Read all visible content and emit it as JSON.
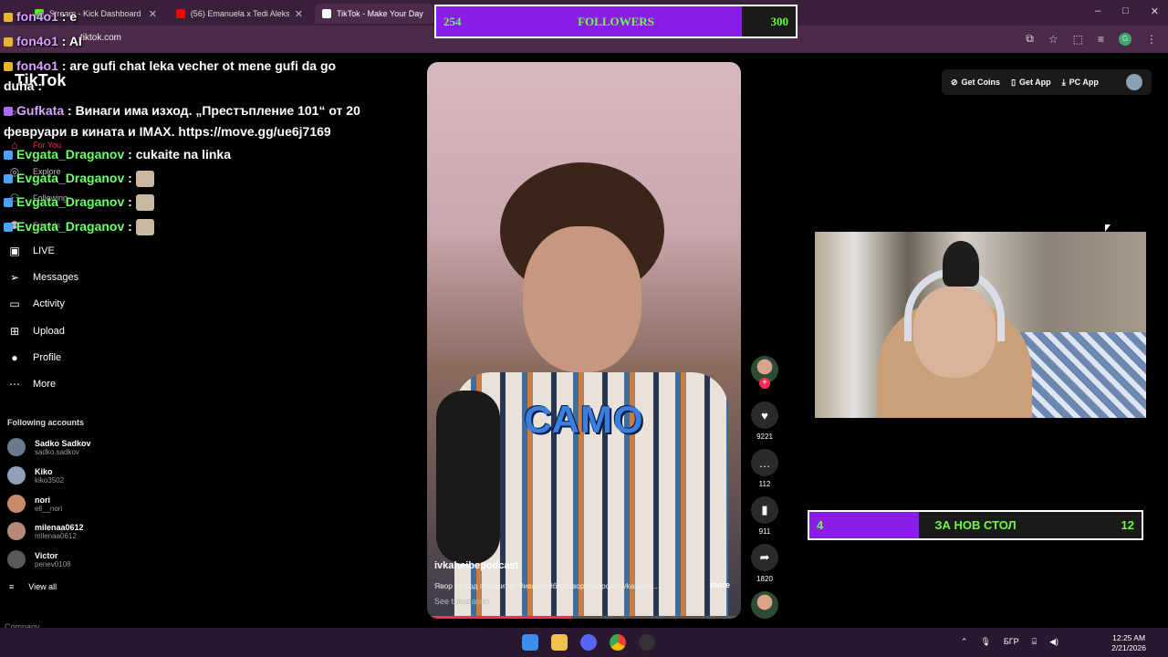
{
  "browser": {
    "tabs": [
      {
        "label": "Stream - Kick Dashboard",
        "color": "#53fc18"
      },
      {
        "label": "(56) Emanuela x Tedi Aleksandro",
        "color": "#ff0000"
      },
      {
        "label": "TikTok - Make Your Day",
        "color": "#ffffff"
      }
    ],
    "url": "tiktok.com",
    "window_controls": {
      "minimize": "–",
      "maximize": "□",
      "close": "✕"
    }
  },
  "tiktok": {
    "logo": "TikTok",
    "nav": [
      {
        "label": "For You",
        "icon": "home-icon"
      },
      {
        "label": "Explore",
        "icon": "compass-icon"
      },
      {
        "label": "Following",
        "icon": "people-icon"
      },
      {
        "label": "Friends",
        "icon": "friends-icon"
      },
      {
        "label": "LIVE",
        "icon": "live-icon"
      },
      {
        "label": "Messages",
        "icon": "send-icon"
      },
      {
        "label": "Activity",
        "icon": "activity-icon"
      },
      {
        "label": "Upload",
        "icon": "upload-icon"
      },
      {
        "label": "Profile",
        "icon": "profile-icon"
      },
      {
        "label": "More",
        "icon": "more-icon"
      }
    ],
    "following_title": "Following accounts",
    "accounts": [
      {
        "name": "Sadko Sadkov",
        "handle": "sadko.sadkov",
        "color": "#6b7b8c"
      },
      {
        "name": "Kiko",
        "handle": "kiko3502",
        "color": "#8fa0b8"
      },
      {
        "name": "nori",
        "handle": "ell__nori",
        "color": "#c98a6c"
      },
      {
        "name": "milenaa0612",
        "handle": "milenaa0612",
        "color": "#b68a78"
      },
      {
        "name": "Victor",
        "handle": "penev0108",
        "color": "#5a5a5a"
      }
    ],
    "view_all": "View all",
    "company": "Company",
    "top_buttons": [
      "Get Coins",
      "Get App",
      "PC App"
    ],
    "messages_badge": "1"
  },
  "chat": [
    {
      "user": "fon4o1",
      "text": " : e"
    },
    {
      "user": "fon4o1",
      "text": " : AI"
    },
    {
      "user": "fon4o1",
      "text": " : are gufi chat leka vecher ot mene gufi da go"
    },
    {
      "user": "",
      "text": "duha :"
    },
    {
      "user": "Gufkata",
      "text": " : Винаги има изход. „Престъпление 101“ от 20"
    },
    {
      "user": "",
      "text": "февруари в кината и IMAX. https://move.gg/ue6j7169"
    },
    {
      "user": "Evgata_Draganov",
      "text": " : cukaite na linka"
    },
    {
      "user": "Evgata_Draganov",
      "text": " : "
    },
    {
      "user": "Evgata_Draganov",
      "text": " : "
    },
    {
      "user": "Evgata_Draganov",
      "text": " : "
    }
  ],
  "video": {
    "caption": "САМО",
    "author": "ivkabeibepodcast",
    "description": "Явор за под прикритие #ивкабейбе #яворбахаров #ivkabeibe...",
    "more": "more",
    "see_translation": "See translation",
    "progress": 0.46,
    "likes": "9221",
    "comments": "112",
    "saves": "911",
    "shares": "1820"
  },
  "followers_goal": {
    "current": "254",
    "label": "FOLLOWERS",
    "target": "300",
    "fraction": 0.85
  },
  "desk_goal": {
    "current": "4",
    "label": "ЗА НОВ СТОЛ",
    "target": "12",
    "fraction": 0.33
  },
  "taskbar": {
    "time": "12:25 AM",
    "date": "2/21/2026",
    "language": "БГР"
  }
}
